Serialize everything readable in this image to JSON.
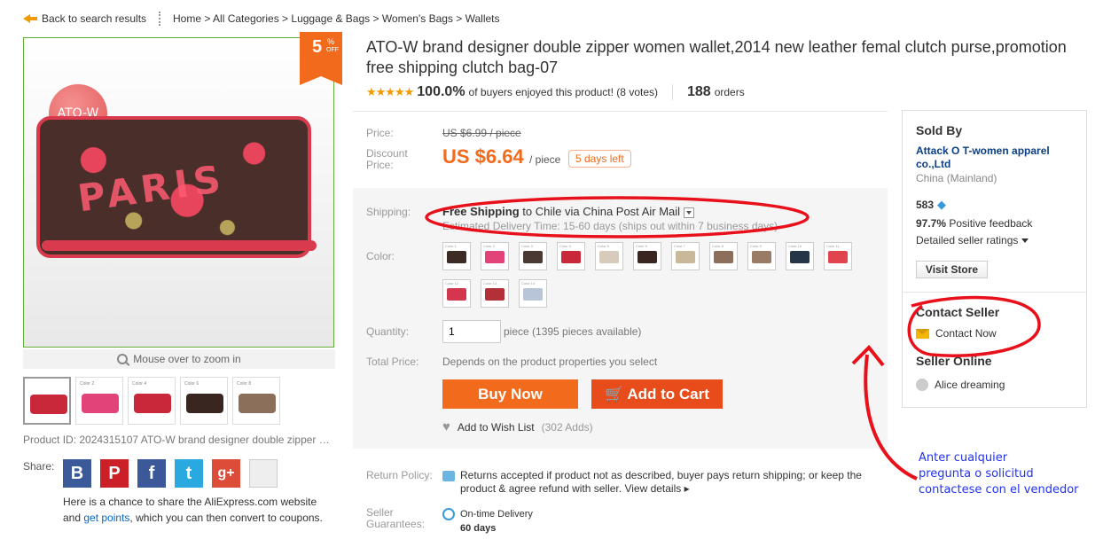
{
  "breadcrumb": {
    "back": "Back to search results",
    "path": "Home > All Categories > Luggage & Bags > Women's Bags > Wallets"
  },
  "gallery": {
    "brand_tag": "ATO-W",
    "wallet_print": "PARIS",
    "discount_badge": {
      "num": "5",
      "pct": "%",
      "off": "OFF"
    },
    "zoom_hint": "Mouse over to zoom in",
    "thumbs": [
      "",
      "Color 2",
      "Color 4",
      "Color 6",
      "Color 8"
    ]
  },
  "product_id": "Product ID: 2024315107 ATO-W brand designer double zipper women wallet",
  "share": {
    "label": "Share:",
    "icons": [
      "B",
      "P",
      "f",
      "t",
      "g+",
      ""
    ],
    "note_1": "Here is a chance to share the AliExpress.com website",
    "note_2a": "and ",
    "note_link": "get points",
    "note_2b": ", which you can then convert to coupons."
  },
  "title": "ATO-W brand designer double zipper women wallet,2014 new leather femal clutch purse,promotion free shipping clutch bag-07",
  "rating": {
    "stars": "★★★★★",
    "percent": "100.0%",
    "text": "of buyers enjoyed this product! (8 votes)",
    "orders_num": "188",
    "orders_label": "orders"
  },
  "price": {
    "label": "Price:",
    "old": "US $6.99 / piece",
    "discount_label": "Discount Price:",
    "current": "US $6.64",
    "per": "/ piece",
    "days_left": "5 days left"
  },
  "shipping": {
    "label": "Shipping:",
    "free": "Free Shipping",
    "dest": " to  Chile via China Post Air Mail",
    "estimate": "Estimated Delivery Time: 15-60 days (ships out within 7 business days)"
  },
  "colors": {
    "label": "Color:",
    "swatches": [
      {
        "name": "Color 1",
        "color": "#3d2b26"
      },
      {
        "name": "Color 2",
        "color": "#e2447a"
      },
      {
        "name": "Color 3",
        "color": "#4a3a33"
      },
      {
        "name": "Color 4",
        "color": "#c8283a"
      },
      {
        "name": "Color 5",
        "color": "#d7ccbb"
      },
      {
        "name": "Color 6",
        "color": "#3a2620"
      },
      {
        "name": "Color 7",
        "color": "#c9b89a"
      },
      {
        "name": "Color 8",
        "color": "#8b6f5a"
      },
      {
        "name": "Color 9",
        "color": "#9a7b66"
      },
      {
        "name": "Color 10",
        "color": "#263548"
      },
      {
        "name": "Color 11",
        "color": "#e0444f"
      },
      {
        "name": "Color 12",
        "color": "#d3364e"
      },
      {
        "name": "Color 13",
        "color": "#b33038"
      },
      {
        "name": "Color 14",
        "color": "#b8c4d8"
      }
    ]
  },
  "quantity": {
    "label": "Quantity:",
    "value": "1",
    "available": "piece (1395 pieces available)"
  },
  "total": {
    "label": "Total Price:",
    "value": "Depends on the product properties you select"
  },
  "actions": {
    "buy_now": "Buy Now",
    "add_to_cart": "Add to Cart",
    "wish": "Add to Wish List",
    "wish_count": "(302 Adds)"
  },
  "return_policy": {
    "label": "Return Policy:",
    "text": "Returns accepted if product not as described, buyer pays return shipping; or keep the product & agree refund with seller.",
    "link": "View details ▸"
  },
  "guarantees": {
    "label": "Seller Guarantees:",
    "title": "On-time Delivery",
    "days": "60 days"
  },
  "seller": {
    "heading": "Sold By",
    "store": "Attack O T-women apparel co.,Ltd",
    "country": "China (Mainland)",
    "score": "583",
    "feedback_pct": "97.7%",
    "feedback_text": "Positive feedback",
    "detailed": "Detailed seller ratings",
    "visit": "Visit Store",
    "contact_heading": "Contact Seller",
    "contact_now": "Contact Now",
    "online_heading": "Seller Online",
    "online_user": "Alice dreaming"
  },
  "annotation": {
    "line1": "Anter cualquier",
    "line2": "pregunta o solicitud",
    "line3": "contactese con el vendedor"
  },
  "theme": {
    "accent_orange": "#f26b1d",
    "annotation_red": "#e8101a",
    "annotation_blue": "#2233ee"
  }
}
